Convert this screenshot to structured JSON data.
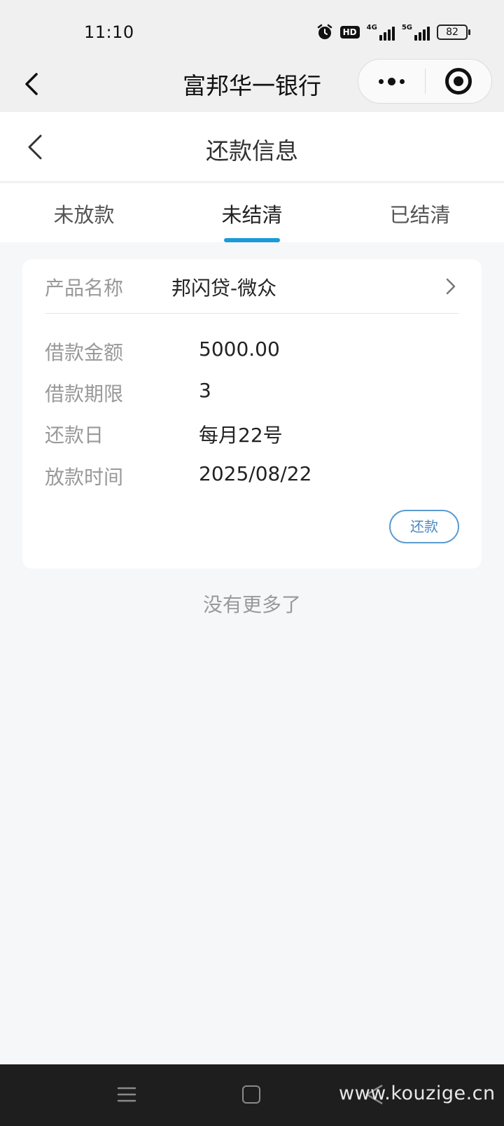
{
  "status_bar": {
    "time": "11:10",
    "hd_label": "HD",
    "net1_label": "4G",
    "net2_label": "5G",
    "battery": "82"
  },
  "mini_program": {
    "title": "富邦华一银行"
  },
  "header": {
    "title": "还款信息"
  },
  "tabs": [
    {
      "label": "未放款",
      "active": false
    },
    {
      "label": "未结清",
      "active": true
    },
    {
      "label": "已结清",
      "active": false
    }
  ],
  "loan": {
    "product_label": "产品名称",
    "product_value": "邦闪贷-微众",
    "rows": [
      {
        "label": "借款金额",
        "value": "5000.00"
      },
      {
        "label": "借款期限",
        "value": "3"
      },
      {
        "label": "还款日",
        "value": "每月22号"
      },
      {
        "label": "放款时间",
        "value": "2025/08/22"
      }
    ],
    "repay_button": "还款"
  },
  "footer_text": "没有更多了",
  "watermark": "www.kouzige.cn",
  "colors": {
    "accent": "#1a9ad6",
    "button_border": "#5b9bd0",
    "background": "#f6f7f9"
  }
}
